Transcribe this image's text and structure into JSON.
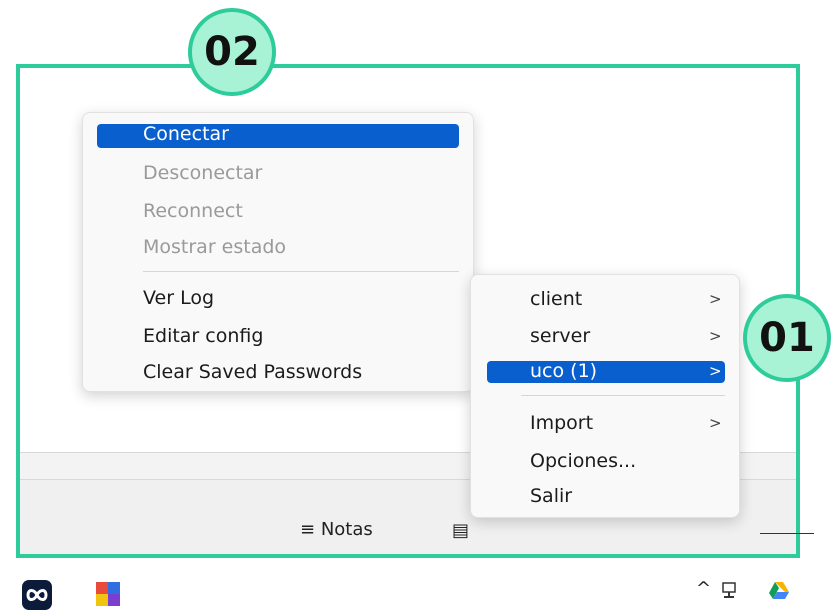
{
  "badges": {
    "first": "02",
    "second": "01"
  },
  "taskbar": {
    "notes_label": "Notas",
    "notes_icon": "notes-lines-icon",
    "tray_chevron": "^"
  },
  "menu_left": {
    "items": [
      {
        "label": "Conectar",
        "state": "highlighted"
      },
      {
        "label": "Desconectar",
        "state": "disabled"
      },
      {
        "label": "Reconnect",
        "state": "disabled"
      },
      {
        "label": "Mostrar estado",
        "state": "disabled"
      },
      {
        "label": "Ver Log",
        "state": "enabled"
      },
      {
        "label": "Editar config",
        "state": "enabled"
      },
      {
        "label": "Clear Saved Passwords",
        "state": "enabled"
      }
    ]
  },
  "menu_right": {
    "items": [
      {
        "label": "client",
        "submenu": true
      },
      {
        "label": "server",
        "submenu": true
      },
      {
        "label": "uco (1)",
        "submenu": true,
        "state": "highlighted"
      },
      {
        "label": "Import",
        "submenu": true
      },
      {
        "label": "Opciones...",
        "submenu": false
      },
      {
        "label": "Salir",
        "submenu": false
      }
    ],
    "submenu_glyph": ">"
  },
  "colors": {
    "accent": "#2ecc9a",
    "badge_fill": "#a8f3d6",
    "highlight": "#0a5fcf"
  }
}
